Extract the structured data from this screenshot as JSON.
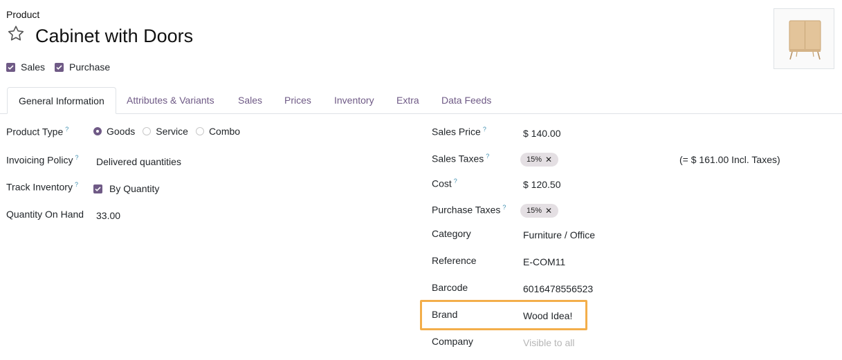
{
  "header": {
    "breadcrumb": "Product",
    "title": "Cabinet with Doors",
    "checkboxes": [
      {
        "label": "Sales",
        "checked": true
      },
      {
        "label": "Purchase",
        "checked": true
      }
    ]
  },
  "tabs": [
    {
      "label": "General Information",
      "active": true
    },
    {
      "label": "Attributes & Variants"
    },
    {
      "label": "Sales"
    },
    {
      "label": "Prices"
    },
    {
      "label": "Inventory"
    },
    {
      "label": "Extra"
    },
    {
      "label": "Data Feeds"
    }
  ],
  "left_fields": {
    "product_type": {
      "label": "Product Type",
      "help": "?",
      "options": [
        "Goods",
        "Service",
        "Combo"
      ],
      "selected": "Goods"
    },
    "invoicing_policy": {
      "label": "Invoicing Policy",
      "help": "?",
      "value": "Delivered quantities"
    },
    "track_inventory": {
      "label": "Track Inventory",
      "help": "?",
      "value": "By Quantity",
      "checked": true
    },
    "quantity_on_hand": {
      "label": "Quantity On Hand",
      "value": "33.00"
    }
  },
  "right_fields": {
    "sales_price": {
      "label": "Sales Price",
      "help": "?",
      "value": "$ 140.00"
    },
    "sales_taxes": {
      "label": "Sales Taxes",
      "help": "?",
      "tag": "15%",
      "incl_note": "(= $ 161.00 Incl. Taxes)"
    },
    "cost": {
      "label": "Cost",
      "help": "?",
      "value": "$ 120.50"
    },
    "purchase_taxes": {
      "label": "Purchase Taxes",
      "help": "?",
      "tag": "15%"
    },
    "category": {
      "label": "Category",
      "value": "Furniture / Office"
    },
    "reference": {
      "label": "Reference",
      "value": "E-COM11"
    },
    "barcode": {
      "label": "Barcode",
      "value": "6016478556523"
    },
    "brand": {
      "label": "Brand",
      "value": "Wood Idea!"
    },
    "company": {
      "label": "Company",
      "placeholder": "Visible to all"
    }
  },
  "colors": {
    "accent": "#6f5a86",
    "highlight": "#f3ae4a",
    "help": "#3f8fb0"
  },
  "icons": {
    "favorite": "star-outline-icon",
    "tag_remove": "close-icon"
  }
}
